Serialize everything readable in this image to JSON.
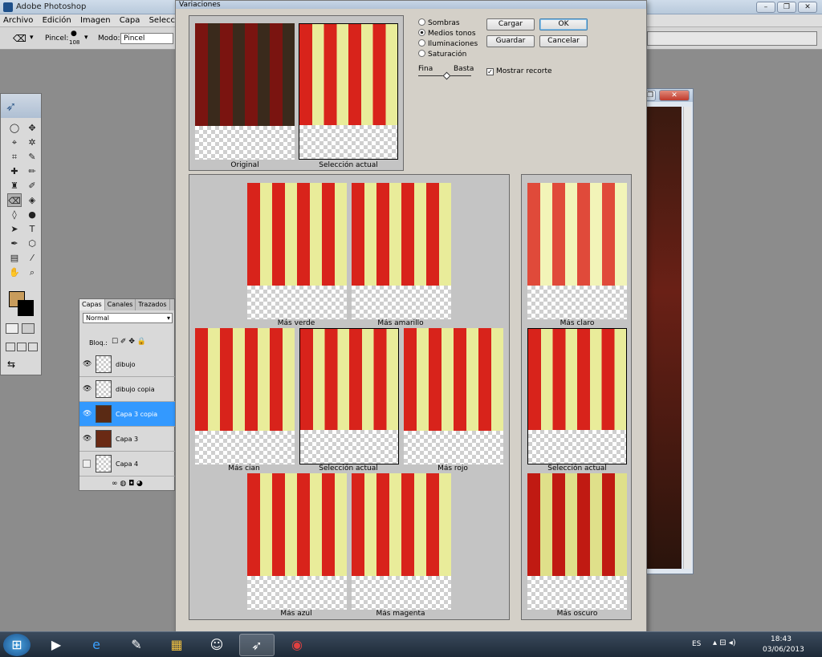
{
  "app": {
    "title": "Adobe Photoshop"
  },
  "menu": [
    "Archivo",
    "Edición",
    "Imagen",
    "Capa",
    "Selección"
  ],
  "options": {
    "brush_label": "Pincel:",
    "brush_size": "108",
    "mode_label": "Modo:",
    "mode_value": "Pincel"
  },
  "layers_panel": {
    "tabs": [
      "Capas",
      "Canales",
      "Trazados"
    ],
    "blend_mode": "Normal",
    "lock_label": "Bloq.:",
    "layers": [
      {
        "name": "dibujo",
        "visible": true,
        "selected": false
      },
      {
        "name": "dibujo copia",
        "visible": true,
        "selected": false
      },
      {
        "name": "Capa 3 copia",
        "visible": true,
        "selected": true
      },
      {
        "name": "Capa 3",
        "visible": true,
        "selected": false
      },
      {
        "name": "Capa 4",
        "visible": false,
        "selected": false
      }
    ]
  },
  "dialog": {
    "title": "Variaciones",
    "original_label": "Original",
    "current_label": "Selección actual",
    "tones": [
      "Sombras",
      "Medios tonos",
      "Iluminaciones",
      "Saturación"
    ],
    "tone_selected": "Medios tonos",
    "fine_label": "Fina",
    "coarse_label": "Basta",
    "show_clipping_label": "Mostrar recorte",
    "show_clipping_checked": true,
    "buttons": {
      "load": "Cargar",
      "ok": "OK",
      "save": "Guardar",
      "cancel": "Cancelar"
    },
    "variations": {
      "green": "Más verde",
      "yellow": "Más amarillo",
      "cyan": "Más cian",
      "current": "Selección actual",
      "red": "Más rojo",
      "blue": "Más azul",
      "magenta": "Más magenta"
    },
    "brightness": {
      "lighter": "Más claro",
      "current": "Selección actual",
      "darker": "Más oscuro"
    }
  },
  "taskbar": {
    "lang": "ES",
    "time": "18:43",
    "date": "03/06/2013"
  }
}
